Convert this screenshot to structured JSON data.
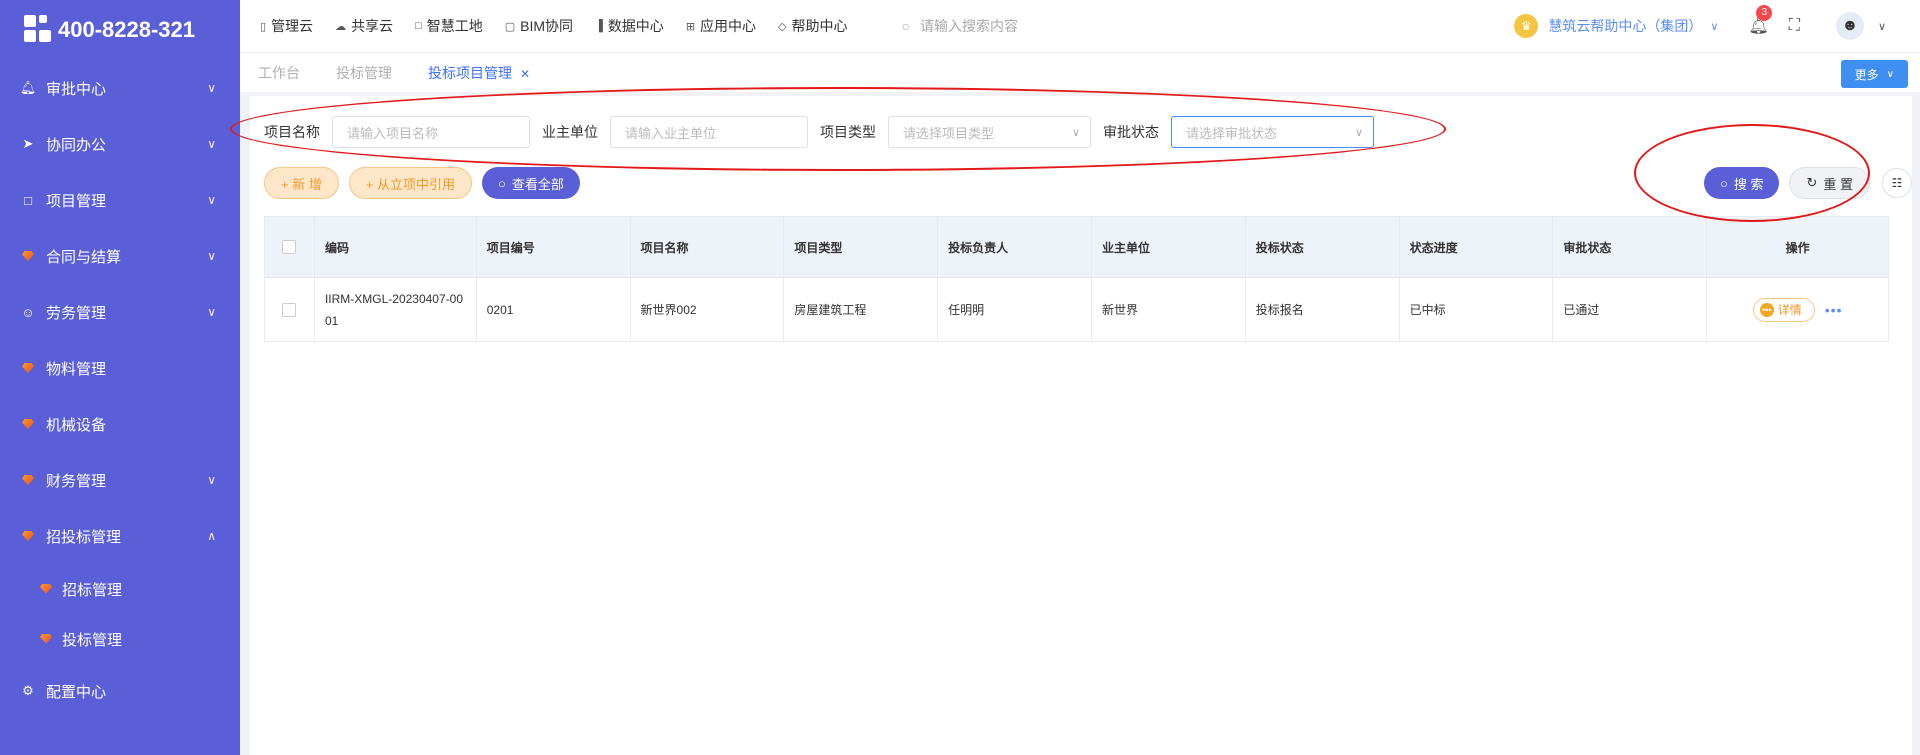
{
  "sidebar": {
    "phone": "400-8228-321",
    "items": [
      {
        "label": "审批中心",
        "icon": "bell-icon",
        "expanded": false
      },
      {
        "label": "协同办公",
        "icon": "send-icon",
        "expanded": false
      },
      {
        "label": "项目管理",
        "icon": "book-icon",
        "expanded": false
      },
      {
        "label": "合同与结算",
        "icon": "gem-icon",
        "expanded": false
      },
      {
        "label": "劳务管理",
        "icon": "user-icon",
        "expanded": false
      },
      {
        "label": "物料管理",
        "icon": "gem-icon"
      },
      {
        "label": "机械设备",
        "icon": "gem-icon"
      },
      {
        "label": "财务管理",
        "icon": "gem-icon",
        "expanded": false
      },
      {
        "label": "招投标管理",
        "icon": "gem-icon",
        "expanded": true
      },
      {
        "label": "配置中心",
        "icon": "gear-icon"
      }
    ],
    "sub_items": [
      {
        "label": "招标管理"
      },
      {
        "label": "投标管理"
      }
    ]
  },
  "topnav": {
    "items": [
      {
        "label": "管理云"
      },
      {
        "label": "共享云"
      },
      {
        "label": "智慧工地"
      },
      {
        "label": "BIM协同"
      },
      {
        "label": "数据中心"
      },
      {
        "label": "应用中心"
      },
      {
        "label": "帮助中心"
      }
    ],
    "search_placeholder": "请输入搜索内容",
    "help_center": "慧筑云帮助中心（集团）",
    "notification_count": "3"
  },
  "tabs": [
    {
      "label": "工作台",
      "active": false
    },
    {
      "label": "投标管理",
      "active": false
    },
    {
      "label": "投标项目管理",
      "active": true
    }
  ],
  "more_label": "更多",
  "filters": {
    "project_name_label": "项目名称",
    "project_name_placeholder": "请输入项目名称",
    "owner_label": "业主单位",
    "owner_placeholder": "请输入业主单位",
    "type_label": "项目类型",
    "type_placeholder": "请选择项目类型",
    "approval_label": "审批状态",
    "approval_placeholder": "请选择审批状态"
  },
  "actions": {
    "add": "+ 新 增",
    "import": "+ 从立项中引用",
    "view_all": "查看全部",
    "search": "搜 索",
    "reset": "重 置"
  },
  "table": {
    "headers": [
      "编码",
      "项目编号",
      "项目名称",
      "项目类型",
      "投标负责人",
      "业主单位",
      "投标状态",
      "状态进度",
      "审批状态",
      "操作"
    ],
    "rows": [
      {
        "code": "IIRM-XMGL-20230407-0001",
        "project_no": "0201",
        "project_name": "新世界002",
        "project_type": "房屋建筑工程",
        "bid_owner": "任明明",
        "owner_unit": "新世界",
        "bid_status": "投标报名",
        "progress": "已中标",
        "approval": "已通过",
        "detail": "详情"
      }
    ]
  },
  "colors": {
    "sidebar": "#5b5fd7",
    "accent": "#3d72ff",
    "orange": "#f09a2c",
    "annotation": "#e31818"
  }
}
